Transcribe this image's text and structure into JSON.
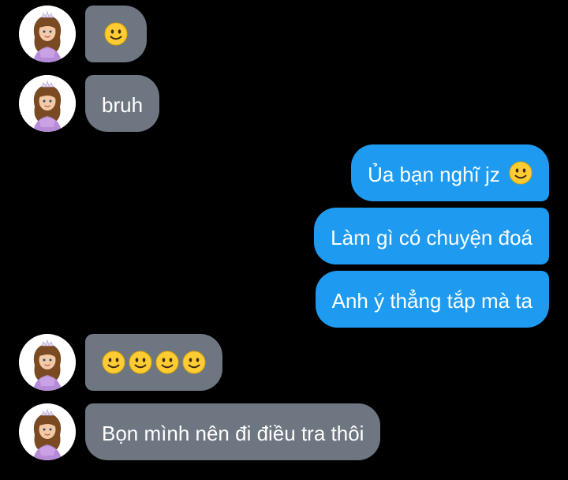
{
  "colors": {
    "background": "#000000",
    "incoming_bubble": "#6e7681",
    "outgoing_bubble": "#1e9bf0",
    "text": "#ffffff",
    "emoji": "#ffcc33"
  },
  "messages": [
    {
      "sender": "other",
      "emoji_count": 1,
      "icon": "slightly-smiling-face-icon"
    },
    {
      "sender": "other",
      "text": "bruh"
    },
    {
      "sender": "me",
      "text": "Ủa bạn nghĩ jz",
      "emoji_count": 1,
      "icon": "slightly-smiling-face-icon"
    },
    {
      "sender": "me",
      "text": "Làm gì có chuyện đoá"
    },
    {
      "sender": "me",
      "text": "Anh ý thẳng tắp mà ta"
    },
    {
      "sender": "other",
      "emoji_count": 4,
      "icon": "slightly-smiling-face-icon"
    },
    {
      "sender": "other",
      "text": "Bọn mình nên đi điều tra thôi"
    }
  ],
  "avatar_icon": "princess-avatar-icon"
}
